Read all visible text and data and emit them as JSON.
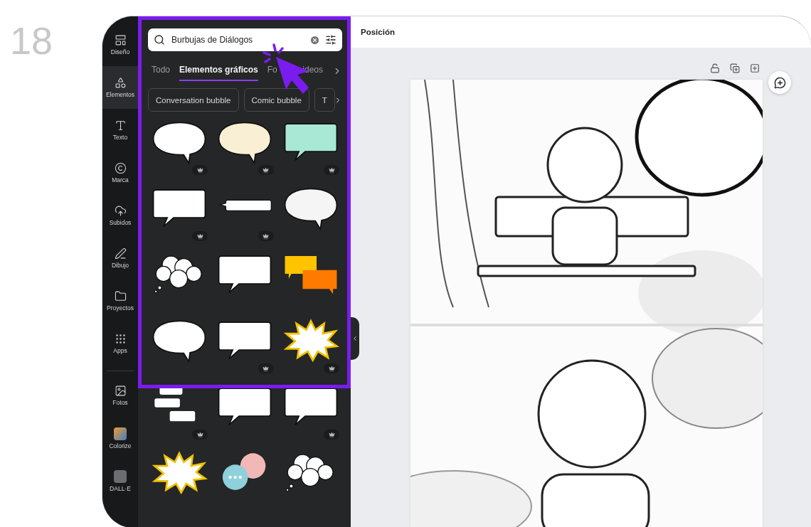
{
  "step_number": "18",
  "sidebar": {
    "items": [
      {
        "label": "Diseño",
        "selected": false
      },
      {
        "label": "Elementos",
        "selected": true
      },
      {
        "label": "Texto",
        "selected": false
      },
      {
        "label": "Marca",
        "selected": false
      },
      {
        "label": "Subidos",
        "selected": false
      },
      {
        "label": "Dibujo",
        "selected": false
      },
      {
        "label": "Proyectos",
        "selected": false
      },
      {
        "label": "Apps",
        "selected": false
      }
    ],
    "apps": [
      {
        "label": "Fotos",
        "kind": "icon"
      },
      {
        "label": "Colorize",
        "kind": "app"
      },
      {
        "label": "DALL·E",
        "kind": "app"
      }
    ]
  },
  "panel": {
    "search": {
      "value": "Burbujas de Diálogos"
    },
    "tabs": [
      {
        "label": "Todo",
        "selected": false
      },
      {
        "label": "Elementos gráficos",
        "selected": true
      },
      {
        "label": "Fo",
        "selected": false
      },
      {
        "label": "ideos",
        "selected": false
      }
    ],
    "chips": [
      "Conversation bubble",
      "Comic bubble",
      "T"
    ],
    "tiles": [
      {
        "kind": "oval",
        "color": "#ffffff",
        "premium": true
      },
      {
        "kind": "oval",
        "color": "#f8efd4",
        "premium": true
      },
      {
        "kind": "rect",
        "color": "#a8e8d4",
        "premium": true
      },
      {
        "kind": "rect",
        "color": "#ffffff",
        "premium": true
      },
      {
        "kind": "thin",
        "color": "#ffffff",
        "premium": true
      },
      {
        "kind": "oval",
        "color": "#f5f5f5",
        "premium": false
      },
      {
        "kind": "cloud",
        "color": "#ffffff",
        "premium": false
      },
      {
        "kind": "rect",
        "color": "#ffffff",
        "premium": false
      },
      {
        "kind": "double",
        "color": "#ffc400",
        "premium": false
      },
      {
        "kind": "oval",
        "color": "#ffffff",
        "premium": false
      },
      {
        "kind": "rect",
        "color": "#ffffff",
        "premium": true
      },
      {
        "kind": "burst",
        "color": "#ffffff",
        "premium": true
      },
      {
        "kind": "stack",
        "color": "#ffffff",
        "premium": true
      },
      {
        "kind": "rect",
        "color": "#ffffff",
        "premium": false
      },
      {
        "kind": "rect",
        "color": "#ffffff",
        "premium": true
      },
      {
        "kind": "burst",
        "color": "#ffffff",
        "premium": false
      },
      {
        "kind": "dots",
        "color": "#f2b8b8",
        "premium": false
      },
      {
        "kind": "cloud",
        "color": "#ffffff",
        "premium": false
      }
    ]
  },
  "canvas": {
    "toolbar_title": "Posición"
  }
}
